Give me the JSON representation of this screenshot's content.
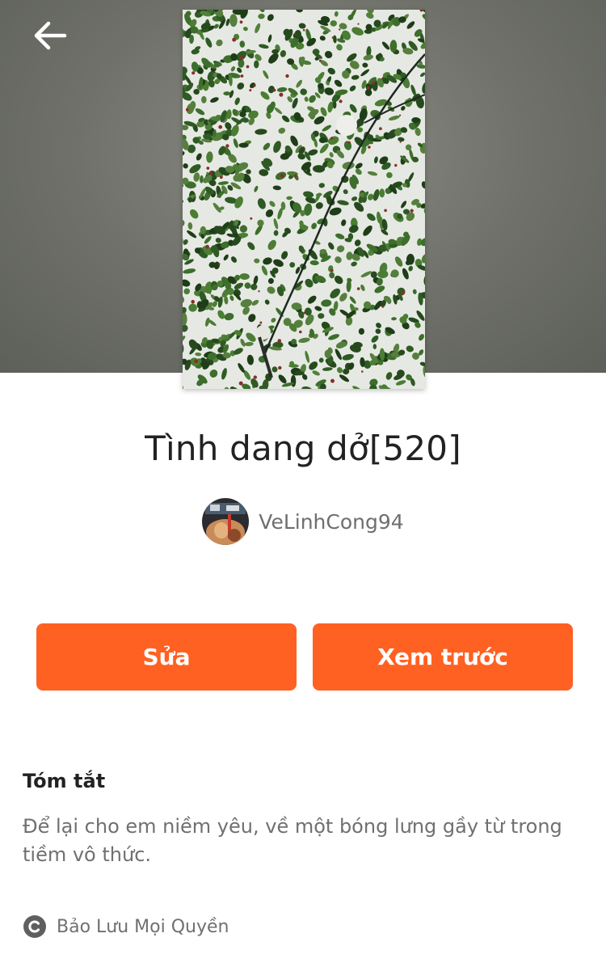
{
  "header": {
    "back_icon": "arrow-left-icon"
  },
  "story": {
    "cover_image": "cover-photo-hanging-leaves-with-lightbulbs",
    "title": "Tình dang dở[520]",
    "author": {
      "name": "VeLinhCong94",
      "avatar": "user-avatar-photo"
    }
  },
  "actions": {
    "edit_label": "Sửa",
    "preview_label": "Xem trước"
  },
  "summary": {
    "heading": "Tóm tắt",
    "text": "Để lại cho em niềm yêu, về một bóng lưng gầy từ trong tiềm vô thức."
  },
  "footer": {
    "copyright_icon": "copyright-icon",
    "copyright_text": "Bảo Lưu Mọi Quyền"
  },
  "colors": {
    "accent": "#ff6122",
    "hero_background": "#74766f"
  }
}
